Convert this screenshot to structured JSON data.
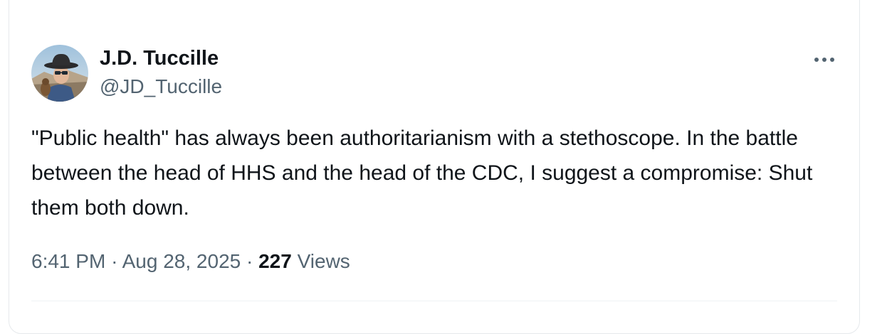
{
  "author": {
    "display_name": "J.D. Tuccille",
    "handle": "@JD_Tuccille"
  },
  "tweet": {
    "text": "\"Public health\" has always been authoritarianism with a stethoscope. In the battle between the head of HHS and the head of the CDC, I suggest a compromise: Shut them both down.",
    "time": "6:41 PM",
    "separator": "·",
    "date": "Aug 28, 2025",
    "views_count": "227",
    "views_label": "Views"
  },
  "icons": {
    "more": "more-horizontal-icon",
    "avatar": "profile-photo"
  },
  "colors": {
    "text_primary": "#0f1419",
    "text_secondary": "#536471",
    "border": "#e6e9ec"
  }
}
